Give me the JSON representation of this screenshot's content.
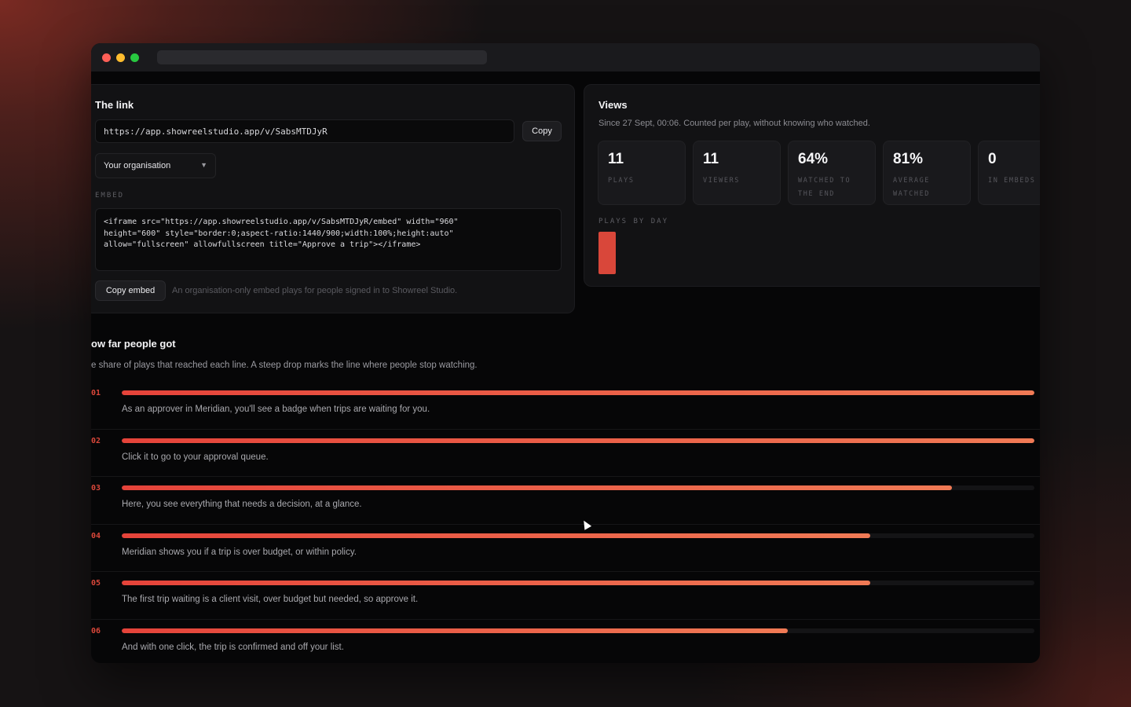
{
  "link": {
    "title": "The link",
    "url": "https://app.showreelstudio.app/v/SabsMTDJyR",
    "copy_label": "Copy",
    "audience_select": "Your organisation",
    "embed_label": "EMBED",
    "embed_lines": [
      "<iframe src=\"https://app.showreelstudio.app/v/SabsMTDJyR/embed\" width=\"960\"",
      "height=\"600\" style=\"border:0;aspect-ratio:1440/900;width:100%;height:auto\"",
      "allow=\"fullscreen\" allowfullscreen title=\"Approve a trip\"></iframe>"
    ],
    "copy_embed_label": "Copy embed",
    "note": "An organisation-only embed plays for people signed in to Showreel Studio."
  },
  "views": {
    "title": "Views",
    "subtitle": "Since 27 Sept, 00:06. Counted per play, without knowing who watched.",
    "stats": [
      {
        "value": "11",
        "label_lines": [
          "PLAYS"
        ]
      },
      {
        "value": "11",
        "label_lines": [
          "VIEWERS"
        ]
      },
      {
        "value": "64%",
        "label_lines": [
          "WATCHED TO",
          "THE END"
        ]
      },
      {
        "value": "81%",
        "label_lines": [
          "AVERAGE",
          "WATCHED"
        ]
      },
      {
        "value": "0",
        "label_lines": [
          "IN EMBEDS"
        ]
      }
    ],
    "plays_by_day_label": "PLAYS BY DAY"
  },
  "progress": {
    "title": "ow far people got",
    "subtitle": "e share of plays that reached each line. A steep drop marks the line where people stop watching.",
    "rows": [
      {
        "num": "01",
        "reached": 1.0,
        "text": "As an approver in Meridian, you'll see a badge when trips are waiting for you."
      },
      {
        "num": "02",
        "reached": 1.0,
        "text": "Click it to go to your approval queue."
      },
      {
        "num": "03",
        "reached": 0.91,
        "text": "Here, you see everything that needs a decision, at a glance."
      },
      {
        "num": "04",
        "reached": 0.82,
        "text": "Meridian shows you if a trip is over budget, or within policy."
      },
      {
        "num": "05",
        "reached": 0.82,
        "text": "The first trip waiting is a client visit, over budget but needed, so approve it."
      },
      {
        "num": "06",
        "reached": 0.73,
        "text": "And with one click, the trip is confirmed and off your list."
      }
    ]
  },
  "colors": {
    "accent": "#e5433a",
    "accent_end": "#f07a55"
  }
}
